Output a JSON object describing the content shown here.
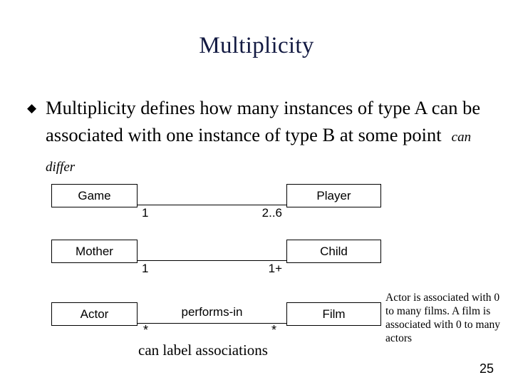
{
  "slide": {
    "title": "Multiplicity",
    "page_number": "25",
    "title_color": "#131a42",
    "text_color": "#000000",
    "background_color": "#ffffff"
  },
  "bullet": {
    "marker": "◆",
    "text": "Multiplicity defines how many instances of type A can be associated with one instance of type B at some point",
    "inline_note": "can differ"
  },
  "associations": [
    {
      "left_class": "Game",
      "right_class": "Player",
      "left_multiplicity": "1",
      "right_multiplicity": "2..6",
      "label": ""
    },
    {
      "left_class": "Mother",
      "right_class": "Child",
      "left_multiplicity": "1",
      "right_multiplicity": "1+",
      "label": ""
    },
    {
      "left_class": "Actor",
      "right_class": "Film",
      "left_multiplicity": "*",
      "right_multiplicity": "*",
      "label": "performs-in"
    }
  ],
  "side_note": "Actor is associated with 0 to many films. A film is associated with 0 to many actors",
  "caption": "can label associations"
}
